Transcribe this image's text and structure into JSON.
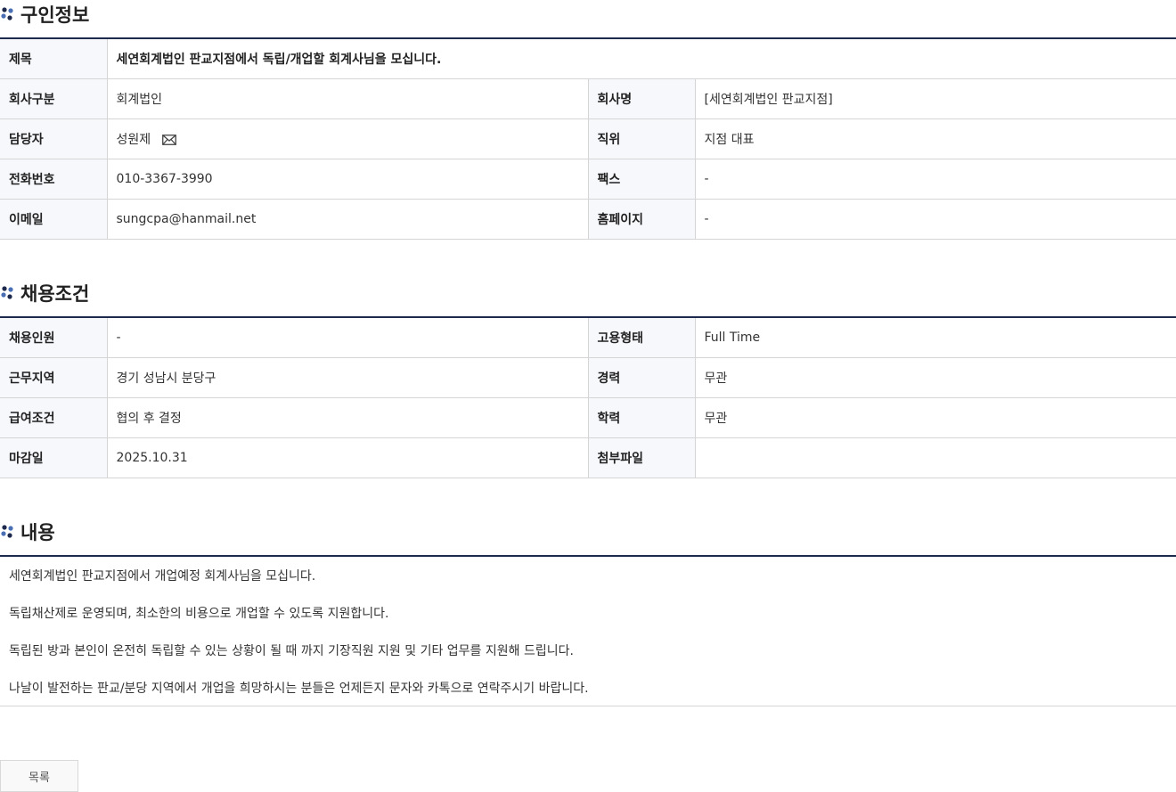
{
  "sections": {
    "recruiter_info": "구인정보",
    "conditions": "채용조건",
    "content": "내용"
  },
  "recruiter": {
    "title_label": "제목",
    "title_value": "세연회계법인 판교지점에서 독립/개업할 회계사님을 모십니다.",
    "company_type_label": "회사구분",
    "company_type_value": "회계법인",
    "company_name_label": "회사명",
    "company_name_value": "[세연회계법인 판교지점]",
    "contact_label": "담당자",
    "contact_value": "성원제",
    "position_label": "직위",
    "position_value": "지점 대표",
    "phone_label": "전화번호",
    "phone_value": "010-3367-3990",
    "fax_label": "팩스",
    "fax_value": "-",
    "email_label": "이메일",
    "email_value": "sungcpa@hanmail.net",
    "homepage_label": "홈페이지",
    "homepage_value": "-"
  },
  "conditions": {
    "headcount_label": "채용인원",
    "headcount_value": "-",
    "employment_type_label": "고용형태",
    "employment_type_value": "Full Time",
    "location_label": "근무지역",
    "location_value": "경기 성남시 분당구",
    "experience_label": "경력",
    "experience_value": "무관",
    "salary_label": "급여조건",
    "salary_value": "협의 후 결정",
    "education_label": "학력",
    "education_value": "무관",
    "deadline_label": "마감일",
    "deadline_value": "2025.10.31",
    "attachment_label": "첨부파일",
    "attachment_value": ""
  },
  "content": {
    "paragraphs": [
      "세연회계법인 판교지점에서 개업예정 회계사님을 모십니다.",
      "독립채산제로 운영되며, 최소한의 비용으로 개업할 수 있도록 지원합니다.",
      "독립된 방과 본인이 온전히 독립할 수 있는 상황이 될 때 까지 기장직원 지원 및 기타 업무를 지원해 드립니다.",
      "나날이 발전하는 판교/분당 지역에서 개업을 희망하시는 분들은 언제든지 문자와 카톡으로 연락주시기 바랍니다."
    ]
  },
  "buttons": {
    "list_label": "목록"
  },
  "icons": {
    "section_bullet": "dots-icon",
    "contact_mail": "mail-icon"
  },
  "colors": {
    "accent": "#1d2a4d",
    "header_cell_bg": "#f7f8fc",
    "border": "#d5d5d5"
  }
}
